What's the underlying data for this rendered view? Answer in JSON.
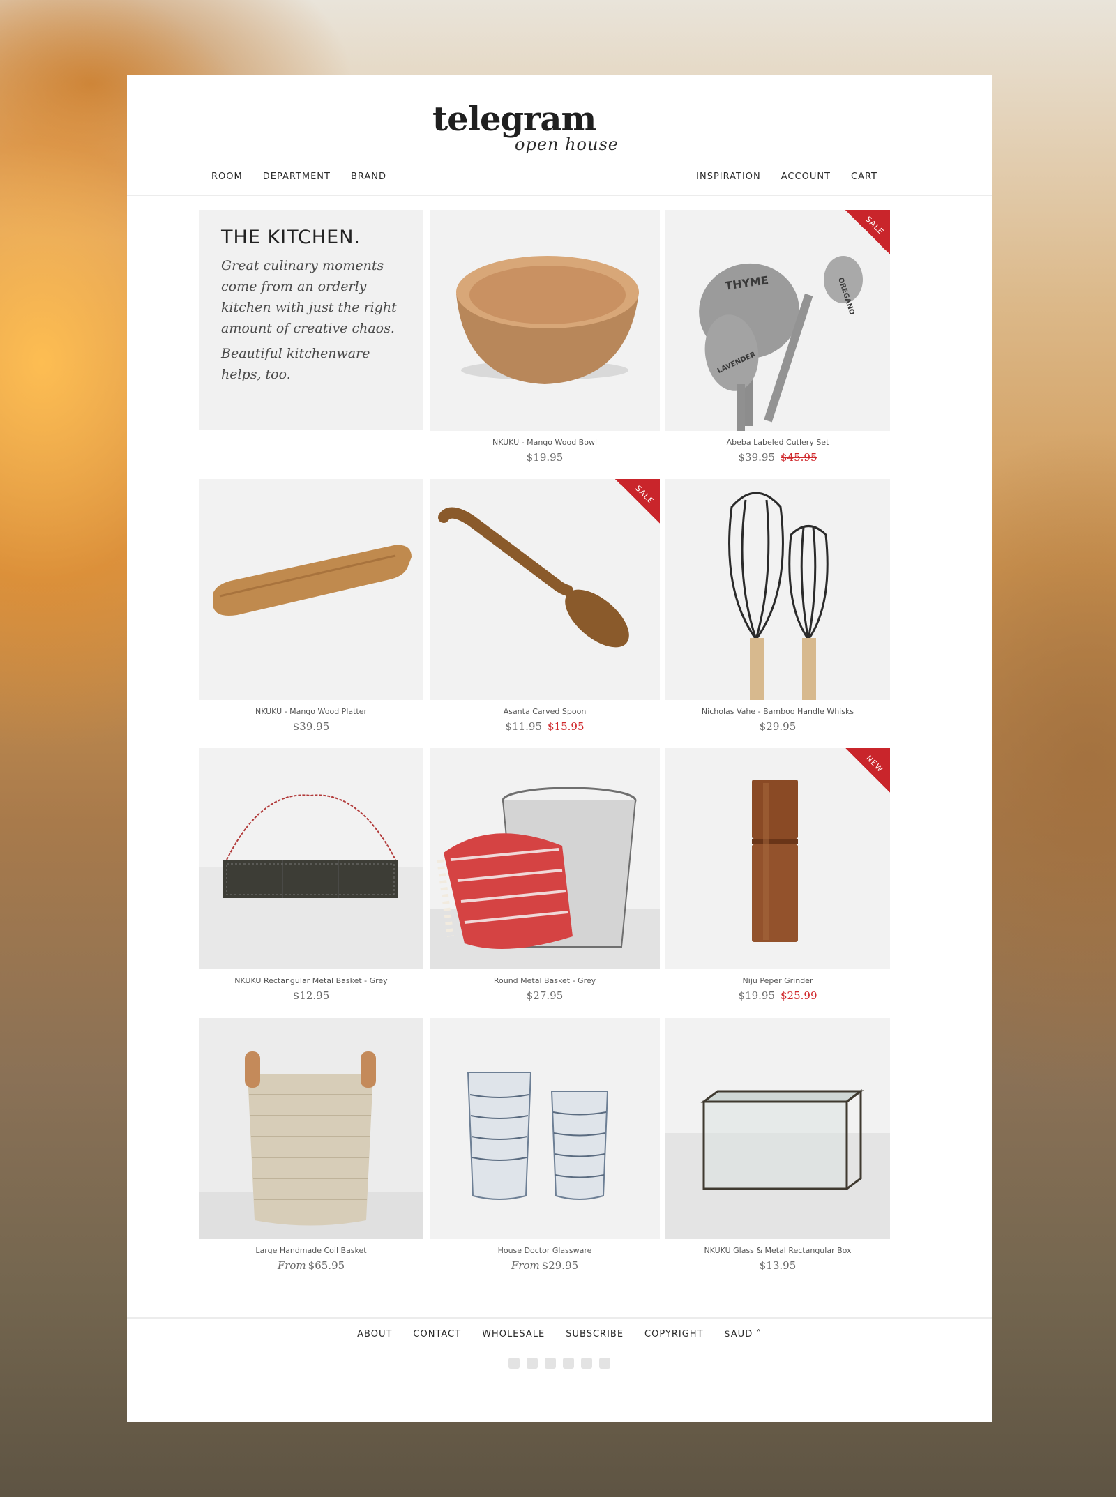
{
  "brand": {
    "name": "telegram",
    "tagline": "open house"
  },
  "nav": {
    "left": [
      "ROOM",
      "DEPARTMENT",
      "BRAND"
    ],
    "right": [
      "INSPIRATION",
      "ACCOUNT",
      "CART"
    ]
  },
  "intro": {
    "title": "THE KITCHEN.",
    "text1": "Great culinary moments come from an orderly kitchen with just the right amount of creative chaos.",
    "text2": "Beautiful kitchenware helps, too."
  },
  "products": [
    {
      "name": "NKUKU - Mango Wood Bowl",
      "price": "$19.95"
    },
    {
      "name": "Abeba Labeled Cutlery Set",
      "price": "$39.95",
      "old_price": "$45.95",
      "badge": "SALE"
    },
    {
      "name": "NKUKU - Mango Wood Platter",
      "price": "$39.95"
    },
    {
      "name": "Asanta Carved Spoon",
      "price": "$11.95",
      "old_price": "$15.95",
      "badge": "SALE"
    },
    {
      "name": "Nicholas Vahe - Bamboo Handle Whisks",
      "price": "$29.95"
    },
    {
      "name": "NKUKU Rectangular Metal Basket - Grey",
      "price": "$12.95"
    },
    {
      "name": "Round Metal Basket - Grey",
      "price": "$27.95"
    },
    {
      "name": "Niju Peper Grinder",
      "price": "$19.95",
      "old_price": "$25.99",
      "badge": "NEW"
    },
    {
      "name": "Large Handmade Coil Basket",
      "price": "$65.95",
      "from": "From"
    },
    {
      "name": "House Doctor Glassware",
      "price": "$29.95",
      "from": "From"
    },
    {
      "name": "NKUKU Glass & Metal Rectangular Box",
      "price": "$13.95"
    }
  ],
  "spoon_labels": [
    "THYME",
    "OREGANO",
    "LAVENDER"
  ],
  "footer": {
    "links": [
      "ABOUT",
      "CONTACT",
      "WHOLESALE",
      "SUBSCRIBE",
      "COPYRIGHT",
      "$AUD ˄"
    ],
    "social_icons": [
      "instagram-icon",
      "twitter-icon",
      "facebook-icon",
      "pinterest-icon",
      "blog-icon",
      "google-plus-icon"
    ]
  },
  "colors": {
    "sale": "#c9252b",
    "panel": "#ffffff",
    "tile": "#f1f1f1"
  }
}
